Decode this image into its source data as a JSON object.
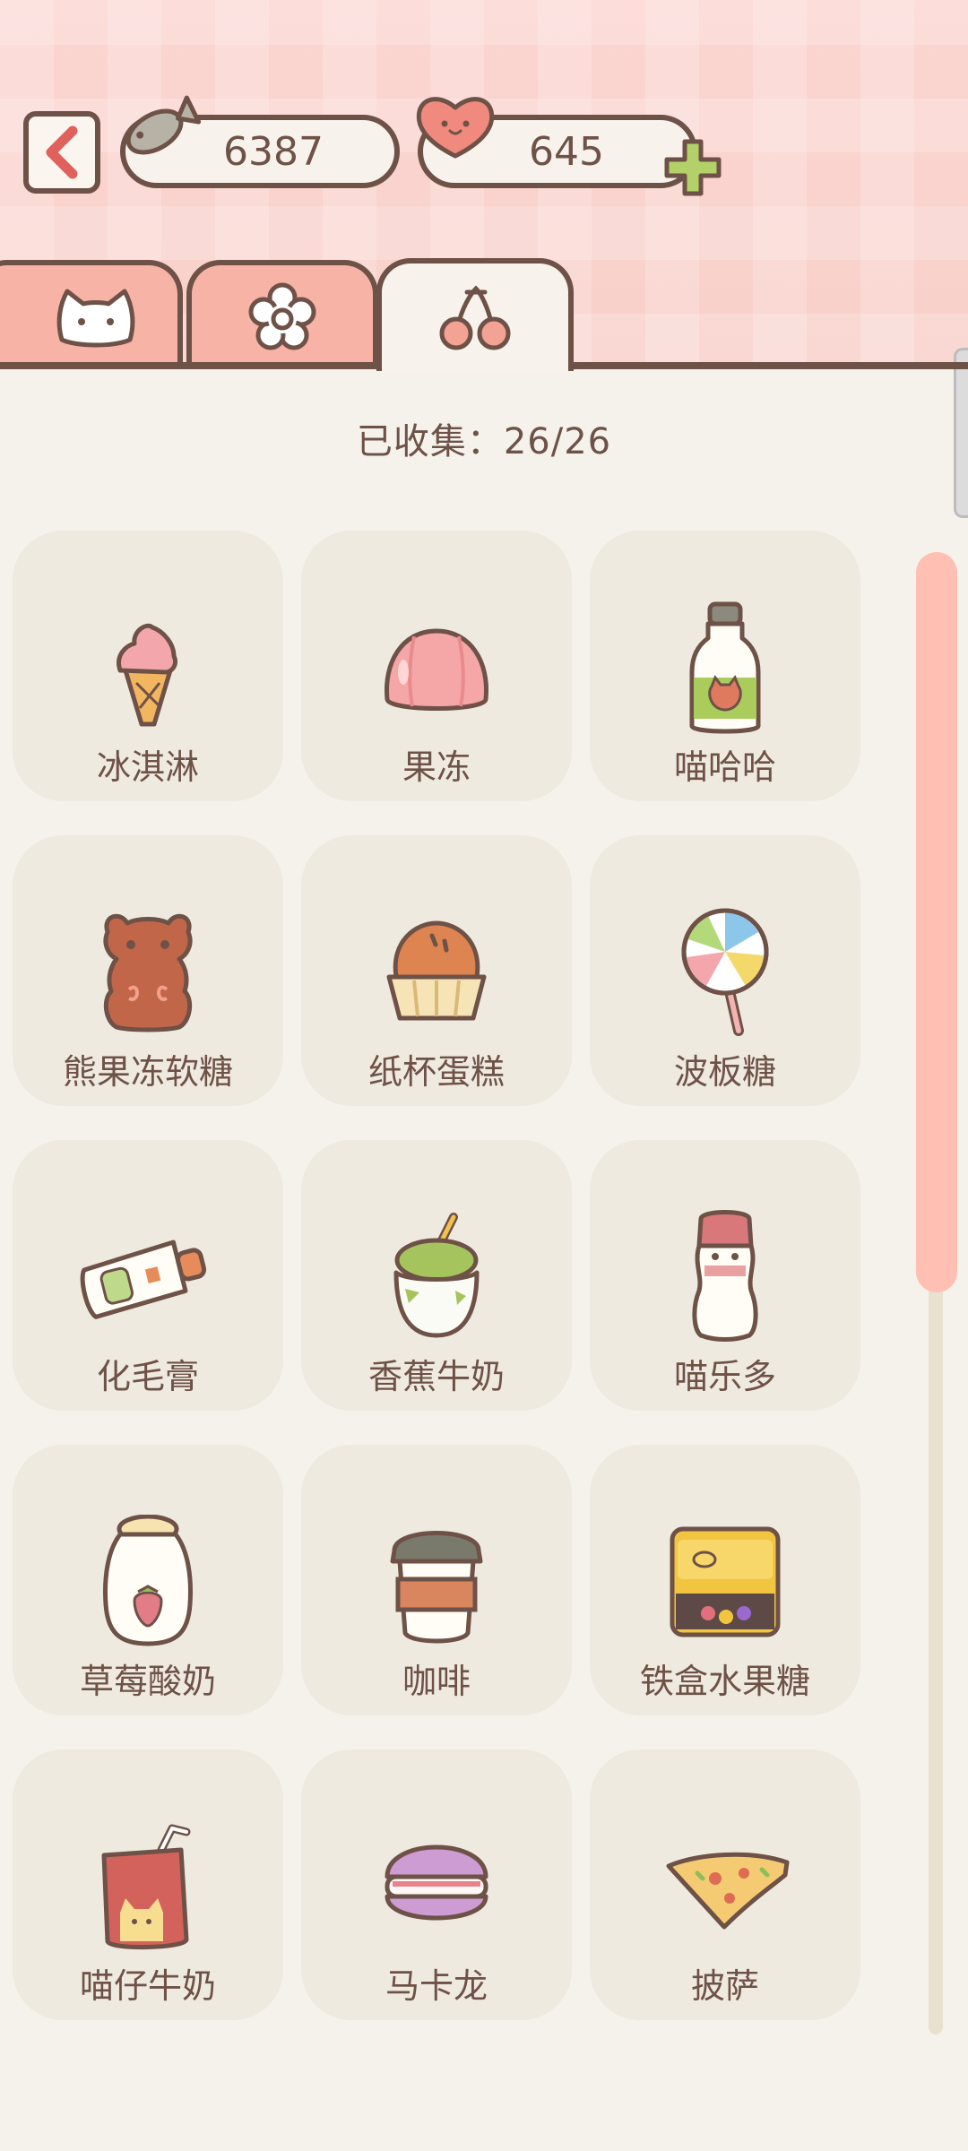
{
  "header": {
    "fish_count": "6387",
    "heart_count": "645"
  },
  "tabs": [
    {
      "icon": "cat-face-icon",
      "active": false
    },
    {
      "icon": "flower-icon",
      "active": false
    },
    {
      "icon": "cherry-icon",
      "active": true
    }
  ],
  "collection": {
    "collected_text": "已收集：26/26"
  },
  "items": [
    {
      "label": "冰淇淋",
      "icon": "ice-cream-icon"
    },
    {
      "label": "果冻",
      "icon": "jelly-icon"
    },
    {
      "label": "喵哈哈",
      "icon": "bottle-drink-icon"
    },
    {
      "label": "熊果冻软糖",
      "icon": "gummy-bear-icon"
    },
    {
      "label": "纸杯蛋糕",
      "icon": "cupcake-icon"
    },
    {
      "label": "波板糖",
      "icon": "lollipop-icon"
    },
    {
      "label": "化毛膏",
      "icon": "paste-tube-icon"
    },
    {
      "label": "香蕉牛奶",
      "icon": "banana-milk-icon"
    },
    {
      "label": "喵乐多",
      "icon": "yogurt-drink-icon"
    },
    {
      "label": "草莓酸奶",
      "icon": "strawberry-yogurt-icon"
    },
    {
      "label": "咖啡",
      "icon": "coffee-cup-icon"
    },
    {
      "label": "铁盒水果糖",
      "icon": "candy-tin-icon"
    },
    {
      "label": "喵仔牛奶",
      "icon": "milk-carton-icon"
    },
    {
      "label": "马卡龙",
      "icon": "macaron-icon"
    },
    {
      "label": "披萨",
      "icon": "pizza-icon"
    }
  ],
  "colors": {
    "outline": "#6e5147",
    "accent_pink": "#f7b3a6",
    "card_bg": "#efeadf",
    "scroll_thumb": "#ffbfb2"
  }
}
